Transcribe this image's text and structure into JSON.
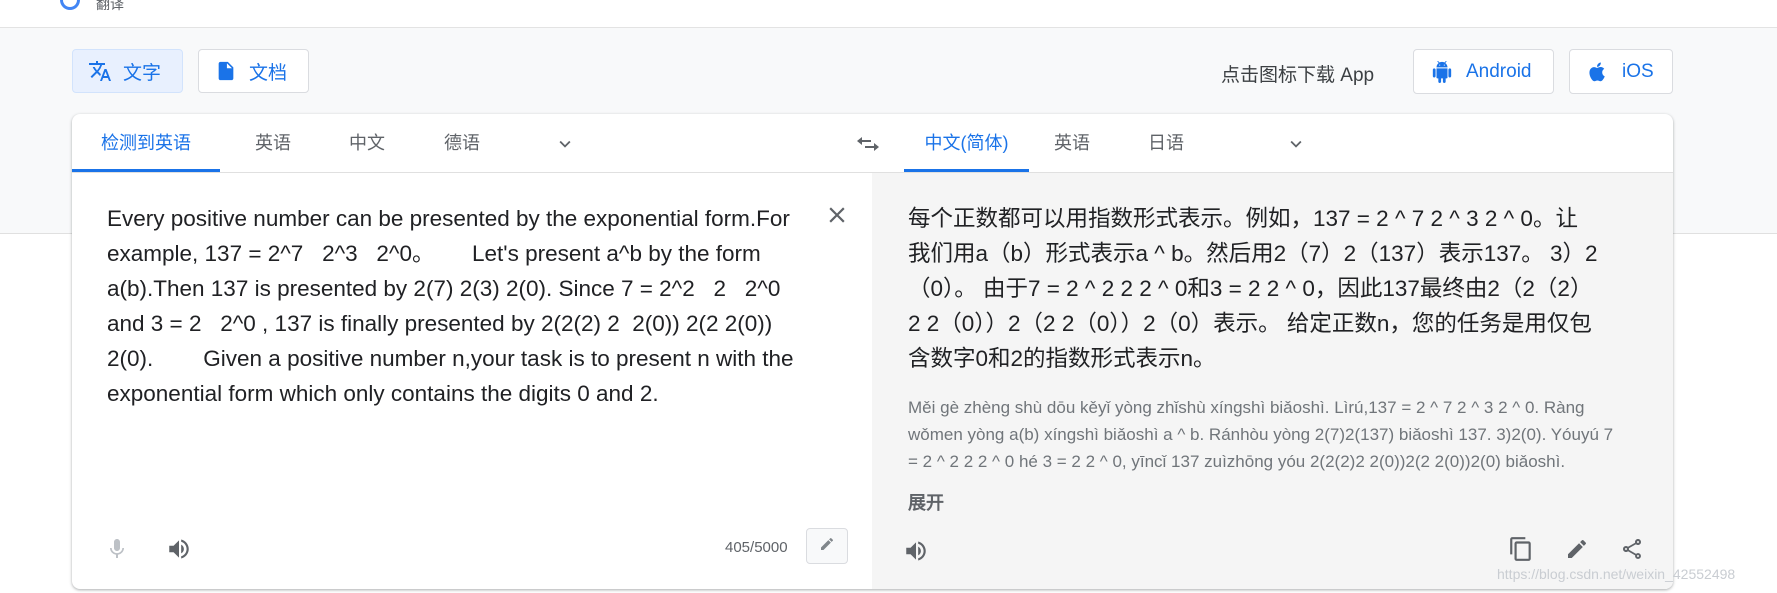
{
  "header": {
    "title_fragment": "翻译"
  },
  "modes": {
    "text_label": "文字",
    "document_label": "文档"
  },
  "app_download": {
    "label": "点击图标下载 App",
    "android_label": "Android",
    "ios_label": "iOS"
  },
  "source": {
    "tabs": [
      "检测到英语",
      "英语",
      "中文",
      "德语"
    ],
    "text": "Every positive number can be presented by the exponential form.For example, 137 = 2^7   2^3   2^0。      Let's present a^b by the form a(b).Then 137 is presented by 2(7) 2(3) 2(0). Since 7 = 2^2   2   2^0 and 3 = 2   2^0 , 137 is finally presented by 2(2(2) 2  2(0)) 2(2 2(0)) 2(0).        Given a positive number n,your task is to present n with the exponential form which only contains the digits 0 and 2.",
    "char_count": "405/5000"
  },
  "target": {
    "tabs": [
      "中文(简体)",
      "英语",
      "日语"
    ],
    "text": "每个正数都可以用指数形式表示。例如，137 = 2 ^ 7 2 ^ 3 2 ^ 0。让我们用a（b）形式表示a ^ b。然后用2（7）2（137）表示137。 3）2（0）。 由于7 = 2 ^ 2 2 2 ^ 0和3 = 2 2 ^ 0，因此137最终由2（2（2）2 2（0））2（2 2（0））2（0）表示。 给定正数n，您的任务是用仅包含数字0和2的指数形式表示n。",
    "pinyin": "Měi gè zhèng shù dōu kěyǐ yòng zhǐshù xíngshì biǎoshì. Lìrú,137 = 2 ^ 7 2 ^ 3 2 ^ 0. Ràng wǒmen yòng a(b) xíngshì biǎoshì a ^ b. Ránhòu yòng 2(7)2(137) biǎoshì 137. 3)2(0). Yóuyú 7 = 2 ^ 2 2 2 ^ 0 hé 3 = 2 2 ^ 0, yīncǐ 137 zuìzhōng yóu 2(2(2)2 2(0))2(2 2(0))2(0) biǎoshì.",
    "expand_label": "展开"
  },
  "watermark": "https://blog.csdn.net/weixin_42552498",
  "colors": {
    "accent": "#1a73e8",
    "active_bg": "#e8f0fe",
    "pane_bg": "#f5f5f5"
  },
  "icons": [
    "translate-icon",
    "document-icon",
    "android-icon",
    "apple-icon",
    "swap-icon",
    "chevron-down-icon",
    "close-icon",
    "mic-icon",
    "speaker-icon",
    "pencil-icon",
    "copy-icon",
    "share-icon"
  ]
}
